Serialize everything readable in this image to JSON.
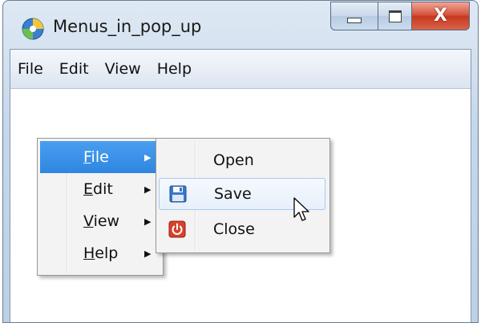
{
  "window": {
    "title": "Menus_in_pop_up",
    "buttons": {
      "minimize_icon": "minimize-icon",
      "maximize_icon": "maximize-icon",
      "close_icon": "close-icon",
      "close_glyph": "X"
    }
  },
  "menubar": {
    "items": [
      {
        "label": "File"
      },
      {
        "label": "Edit"
      },
      {
        "label": "View"
      },
      {
        "label": "Help"
      }
    ]
  },
  "popup_menu": {
    "items": [
      {
        "underline_char": "F",
        "rest": "ile",
        "selected": true,
        "has_submenu": true
      },
      {
        "underline_char": "E",
        "rest": "dit",
        "selected": false,
        "has_submenu": true
      },
      {
        "underline_char": "V",
        "rest": "iew",
        "selected": false,
        "has_submenu": true
      },
      {
        "underline_char": "H",
        "rest": "elp",
        "selected": false,
        "has_submenu": true
      }
    ],
    "arrow_glyph": "▶"
  },
  "submenu": {
    "items": [
      {
        "label": "Open",
        "icon": null,
        "hovered": false
      },
      {
        "label": "Save",
        "icon": "floppy-disk-icon",
        "hovered": true
      },
      {
        "label": "Close",
        "icon": "power-icon",
        "hovered": false
      }
    ]
  },
  "colors": {
    "selection": "#3d93e8",
    "hover_border": "#a9c9ee",
    "close_button": "#c63820"
  }
}
